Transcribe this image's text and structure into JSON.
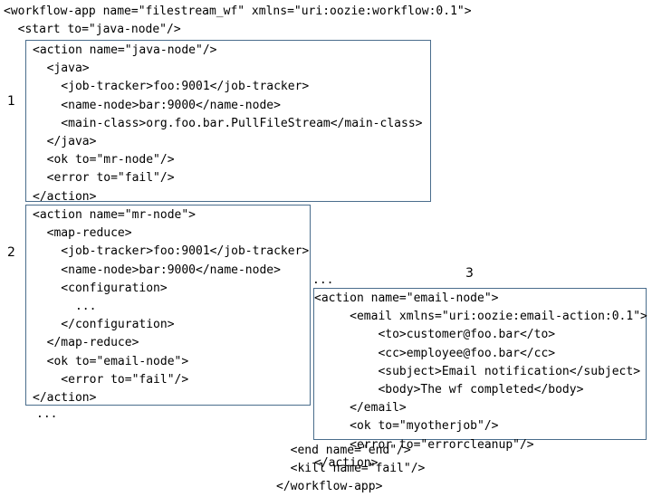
{
  "document": {
    "kind": "oozie-workflow-xml-diagram",
    "accent_color": "#4a6d8c",
    "text_color": "#000000",
    "background_color": "#ffffff"
  },
  "header": {
    "lines": "<workflow-app name=\"filestream_wf\" xmlns=\"uri:oozie:workflow:0.1\">\n  <start to=\"java-node\"/>"
  },
  "boxes": [
    {
      "number": "1",
      "name": "java-node-action-box",
      "code": "<action name=\"java-node\"/>\n  <java>\n    <job-tracker>foo:9001</job-tracker>\n    <name-node>bar:9000</name-node>\n    <main-class>org.foo.bar.PullFileStream</main-class>\n  </java>\n  <ok to=\"mr-node\"/>\n  <error to=\"fail\"/>\n</action>"
    },
    {
      "number": "2",
      "name": "mr-node-action-box",
      "code": "<action name=\"mr-node\">\n  <map-reduce>\n    <job-tracker>foo:9001</job-tracker>\n    <name-node>bar:9000</name-node>\n    <configuration>\n      ...\n    </configuration>\n  </map-reduce>\n  <ok to=\"email-node\">\n    <error to=\"fail\"/>\n</action>"
    },
    {
      "number": "3",
      "name": "email-node-action-box",
      "code": "<action name=\"email-node\">\n     <email xmlns=\"uri:oozie:email-action:0.1\">\n         <to>customer@foo.bar</to>\n         <cc>employee@foo.bar</cc>\n         <subject>Email notification</subject>\n         <body>The wf completed</body>\n     </email>\n     <ok to=\"myotherjob\"/>\n     <error to=\"errorcleanup\"/>\n</action>"
    }
  ],
  "ellipsis": {
    "left": "...",
    "right": "..."
  },
  "footer": {
    "lines": "  <end name=\"end\"/>\n  <kill name=\"fail\"/>\n</workflow-app>"
  }
}
